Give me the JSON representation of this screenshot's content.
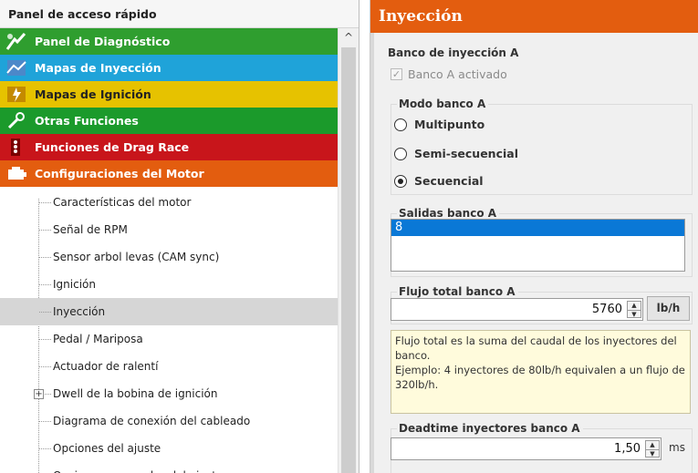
{
  "left_panel": {
    "title": "Panel de acceso rápido",
    "categories": [
      {
        "label": "Panel de Diagnóstico",
        "color": "#2f9e2f",
        "icon": "diagnostic-icon",
        "text_color": "#ffffff"
      },
      {
        "label": "Mapas de Inyección",
        "color": "#1fa3d9",
        "icon": "injection-map-icon",
        "text_color": "#ffffff"
      },
      {
        "label": "Mapas de Ignición",
        "color": "#e6c200",
        "icon": "ignition-map-icon",
        "text_color": "#222222"
      },
      {
        "label": "Otras Funciones",
        "color": "#1b9a2b",
        "icon": "tools-icon",
        "text_color": "#ffffff"
      },
      {
        "label": "Funciones de Drag Race",
        "color": "#c8151b",
        "icon": "drag-race-icon",
        "text_color": "#ffffff"
      },
      {
        "label": "Configuraciones del Motor",
        "color": "#e35d0f",
        "icon": "engine-icon",
        "text_color": "#ffffff"
      }
    ],
    "items": [
      {
        "label": "Características del motor"
      },
      {
        "label": "Señal de RPM"
      },
      {
        "label": "Sensor arbol levas (CAM sync)"
      },
      {
        "label": "Ignición"
      },
      {
        "label": "Inyección",
        "selected": true
      },
      {
        "label": "Pedal / Mariposa"
      },
      {
        "label": "Actuador de ralentí"
      },
      {
        "label": "Dwell de la bobina de ignición",
        "expandable": true
      },
      {
        "label": "Diagrama de conexión del cableado"
      },
      {
        "label": "Opciones del ajuste"
      },
      {
        "label": "Opciones avanzadas del ajuste"
      }
    ],
    "expand_symbol": "+",
    "scroll_up_glyph": "^"
  },
  "right_panel": {
    "header": "Inyección",
    "bank_label": "Banco de inyección A",
    "bank_checkbox": {
      "label": "Banco A activado",
      "checked": true,
      "glyph": "✓"
    },
    "mode_group": {
      "legend": "Modo banco A",
      "options": [
        {
          "label": "Multipunto",
          "selected": false
        },
        {
          "label": "Semi-secuencial",
          "selected": false
        },
        {
          "label": "Secuencial",
          "selected": true
        }
      ]
    },
    "outputs_group": {
      "legend": "Salidas banco A",
      "items": [
        "8"
      ]
    },
    "flow_group": {
      "legend": "Flujo total banco A",
      "value": "5760",
      "unit": "lb/h"
    },
    "info_text": "Flujo total es la suma del caudal de los inyectores del banco.\n Ejemplo: 4 inyectores de 80lb/h equivalen a un flujo de 320lb/h.",
    "deadtime_group": {
      "legend": "Deadtime inyectores banco A",
      "value": "1,50",
      "unit": "ms"
    },
    "spin_up_glyph": "▲",
    "spin_down_glyph": "▼"
  }
}
